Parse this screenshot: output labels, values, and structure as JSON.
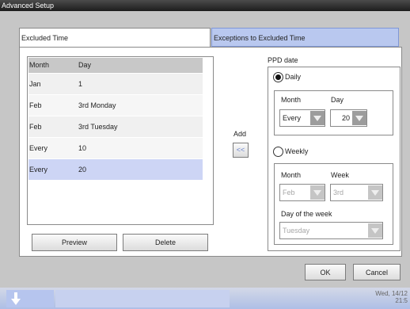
{
  "window": {
    "title": "Advanced Setup"
  },
  "tabs": [
    {
      "label": "Excluded Time"
    },
    {
      "label": "Exceptions to Excluded Time"
    }
  ],
  "table": {
    "headers": [
      "Month",
      "Day"
    ],
    "rows": [
      {
        "month": "Jan",
        "day": "1"
      },
      {
        "month": "Feb",
        "day": "3rd Monday"
      },
      {
        "month": "Feb",
        "day": "3rd Tuesday"
      },
      {
        "month": "Every",
        "day": "10"
      },
      {
        "month": "Every",
        "day": "20"
      }
    ],
    "selected_row": 4
  },
  "buttons": {
    "preview": "Preview",
    "delete": "Delete",
    "add_label": "Add",
    "add_arrow": "<<",
    "ok": "OK",
    "cancel": "Cancel"
  },
  "ppd": {
    "title": "PPD date",
    "daily": {
      "label": "Daily",
      "selected": true,
      "month_label": "Month",
      "day_label": "Day",
      "month_value": "Every",
      "day_value": "20"
    },
    "weekly": {
      "label": "Weekly",
      "selected": false,
      "month_label": "Month",
      "week_label": "Week",
      "month_value": "Feb",
      "week_value": "3rd",
      "dow_label": "Day of the week",
      "dow_value": "Tuesday"
    }
  },
  "taskbar": {
    "datetime_line1": "Wed, 14/12",
    "datetime_line2": "21:5"
  },
  "colors": {
    "selected_row": "#cdd5f5",
    "active_tab": "#b9c8ef",
    "disabled_text": "#a7a7a7"
  },
  "icons": [
    "start-arrow-icon",
    "radio-selected-icon",
    "radio-unselected-icon",
    "dropdown-arrow-icon"
  ]
}
